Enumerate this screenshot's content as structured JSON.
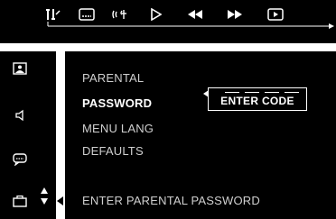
{
  "menu": {
    "items": [
      {
        "label": "PARENTAL"
      },
      {
        "label": "PASSWORD"
      },
      {
        "label": "MENU LANG"
      },
      {
        "label": "DEFAULTS"
      }
    ],
    "selected_index": 1
  },
  "code_entry": {
    "label": "ENTER CODE",
    "digits_entered": 0,
    "total_digits": 4
  },
  "status": {
    "text": "ENTER PARENTAL PASSWORD"
  },
  "top_icons": [
    "settings-icon",
    "subtitle-icon",
    "audio-icon",
    "play-icon",
    "rewind-icon",
    "fast-forward-icon",
    "display-icon"
  ],
  "side_icons": [
    "picture-icon",
    "speaker-icon",
    "chat-icon",
    "briefcase-icon"
  ],
  "colors": {
    "background": "#000000",
    "text": "#ffffff",
    "divider": "#ffffff"
  }
}
